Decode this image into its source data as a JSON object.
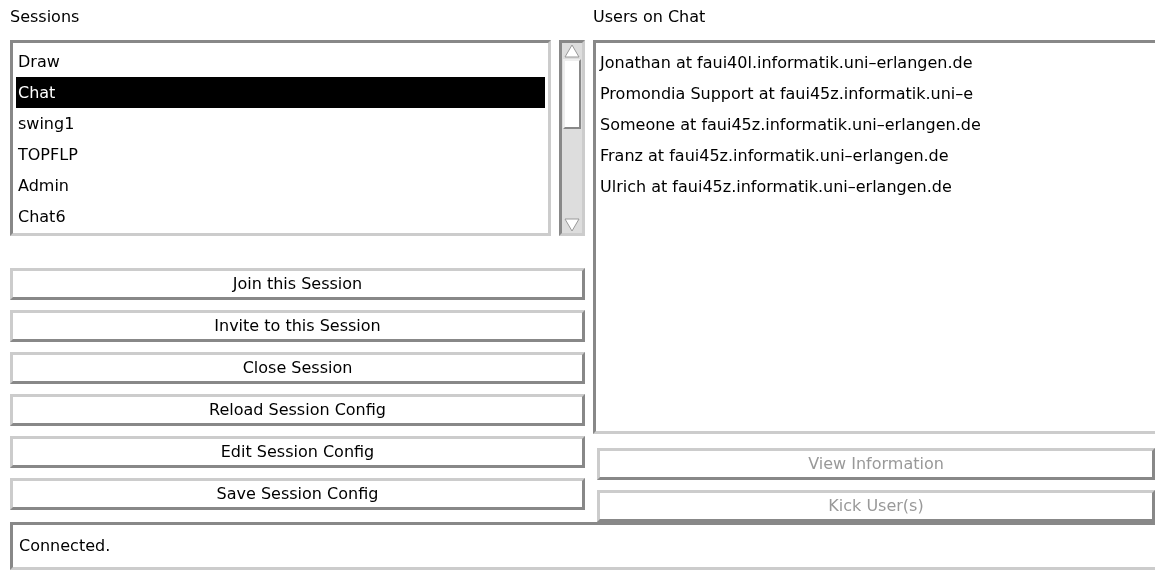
{
  "sessions": {
    "label": "Sessions",
    "items": [
      {
        "name": "Draw",
        "selected": false
      },
      {
        "name": "Chat",
        "selected": true
      },
      {
        "name": "swing1",
        "selected": false
      },
      {
        "name": "TOPFLP",
        "selected": false
      },
      {
        "name": "Admin",
        "selected": false
      },
      {
        "name": "Chat6",
        "selected": false
      }
    ]
  },
  "session_buttons": [
    {
      "label": "Join this Session",
      "disabled": false
    },
    {
      "label": "Invite to this Session",
      "disabled": false
    },
    {
      "label": "Close Session",
      "disabled": false
    },
    {
      "label": "Reload Session Config",
      "disabled": false
    },
    {
      "label": "Edit Session Config",
      "disabled": false
    },
    {
      "label": "Save Session Config",
      "disabled": false
    }
  ],
  "users": {
    "label": "Users on Chat",
    "items": [
      "Jonathan at faui40l.informatik.uni–erlangen.de",
      "Promondia Support at faui45z.informatik.uni–e",
      "Someone at faui45z.informatik.uni–erlangen.de",
      "Franz at faui45z.informatik.uni–erlangen.de",
      "Ulrich at faui45z.informatik.uni–erlangen.de"
    ]
  },
  "user_buttons": [
    {
      "label": "View Information",
      "disabled": true
    },
    {
      "label": "Kick User(s)",
      "disabled": true
    }
  ],
  "status_bar": "Connected."
}
